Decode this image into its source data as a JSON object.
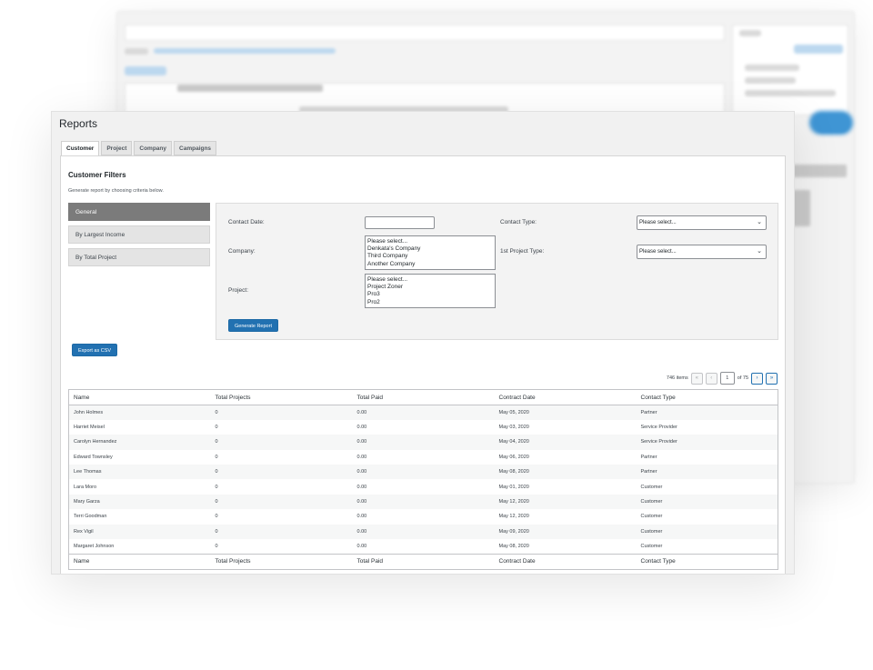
{
  "page_title": "Reports",
  "tabs": [
    {
      "label": "Customer",
      "active": true
    },
    {
      "label": "Project",
      "active": false
    },
    {
      "label": "Company",
      "active": false
    },
    {
      "label": "Campaigns",
      "active": false
    }
  ],
  "filters": {
    "heading": "Customer Filters",
    "description": "Generate report by choosing criteria below.",
    "side_nav": [
      {
        "label": "General",
        "active": true
      },
      {
        "label": "By Largest Income",
        "active": false
      },
      {
        "label": "By Total Project",
        "active": false
      }
    ],
    "contact_date_label": "Contact Date:",
    "contact_date_value": "",
    "company_label": "Company:",
    "company_options": [
      "Please select...",
      "Denkata's Company",
      "Third Company",
      "Another Company"
    ],
    "project_label": "Project:",
    "project_options": [
      "Please select...",
      "Project Zoner",
      "Pro3",
      "Pro2"
    ],
    "contact_type_label": "Contact Type:",
    "contact_type_selected": "Please select...",
    "project_type_label": "1st Project Type:",
    "project_type_selected": "Please select...",
    "generate_button": "Generate Report"
  },
  "export_button": "Export as CSV",
  "pagination": {
    "items_text": "746 items",
    "first": "«",
    "prev": "‹",
    "current_page": "1",
    "of_text": "of 75",
    "next": "›",
    "last": "»"
  },
  "table": {
    "columns": [
      "Name",
      "Total Projects",
      "Total Paid",
      "Contract Date",
      "Contact Type"
    ],
    "rows": [
      [
        "John Holmes",
        "0",
        "0.00",
        "May 05, 2020",
        "Partner"
      ],
      [
        "Harriet Meisel",
        "0",
        "0.00",
        "May 03, 2020",
        "Service Provider"
      ],
      [
        "Carolyn Hernandez",
        "0",
        "0.00",
        "May 04, 2020",
        "Service Provider"
      ],
      [
        "Edward Townsley",
        "0",
        "0.00",
        "May 06, 2020",
        "Partner"
      ],
      [
        "Lee Thomas",
        "0",
        "0.00",
        "May 08, 2020",
        "Partner"
      ],
      [
        "Lara Moro",
        "0",
        "0.00",
        "May 01, 2020",
        "Customer"
      ],
      [
        "Mary Garza",
        "0",
        "0.00",
        "May 12, 2020",
        "Customer"
      ],
      [
        "Terri Goodman",
        "0",
        "0.00",
        "May 12, 2020",
        "Customer"
      ],
      [
        "Rex Vigil",
        "0",
        "0.00",
        "May 09, 2020",
        "Customer"
      ],
      [
        "Margaret Johnson",
        "0",
        "0.00",
        "May 08, 2020",
        "Customer"
      ]
    ]
  },
  "colors": {
    "primary_button": "#2271b1",
    "active_nav": "#7b7b7b"
  }
}
